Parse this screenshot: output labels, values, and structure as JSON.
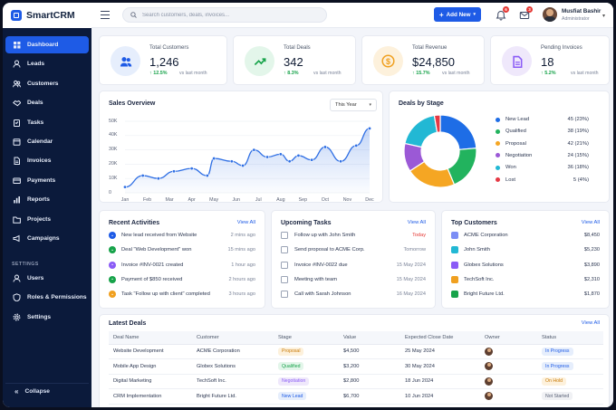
{
  "brand": {
    "name": "SmartCRM"
  },
  "sidebar": {
    "items": [
      {
        "label": "Dashboard",
        "icon": "grid-icon",
        "active": true
      },
      {
        "label": "Leads",
        "icon": "person-icon"
      },
      {
        "label": "Customers",
        "icon": "users-icon"
      },
      {
        "label": "Deals",
        "icon": "handshake-icon"
      },
      {
        "label": "Tasks",
        "icon": "clipboard-icon"
      },
      {
        "label": "Calendar",
        "icon": "calendar-icon"
      },
      {
        "label": "Invoices",
        "icon": "file-icon"
      },
      {
        "label": "Payments",
        "icon": "card-icon"
      },
      {
        "label": "Reports",
        "icon": "chart-icon"
      },
      {
        "label": "Projects",
        "icon": "folder-icon"
      },
      {
        "label": "Campaigns",
        "icon": "megaphone-icon"
      }
    ],
    "settings_header": "SETTINGS",
    "settings_items": [
      {
        "label": "Users",
        "icon": "user-icon"
      },
      {
        "label": "Roles & Permissions",
        "icon": "shield-icon"
      },
      {
        "label": "Settings",
        "icon": "gear-icon"
      }
    ],
    "collapse_label": "Collapse"
  },
  "topbar": {
    "search_placeholder": "Search customers, deals, invoices...",
    "add_new_label": "Add New",
    "notification_count": "6",
    "mail_count": "3",
    "user_name": "Musfiat Bashir",
    "user_role": "Administrator"
  },
  "stats": [
    {
      "label": "Total Customers",
      "value": "1,246",
      "change": "12.5%",
      "vs": "vs last month",
      "color": "#e6eefc",
      "icon_color": "#1e5be6",
      "icon": "users-icon"
    },
    {
      "label": "Total Deals",
      "value": "342",
      "change": "8.3%",
      "vs": "vs last month",
      "color": "#e3f6ea",
      "icon_color": "#17a34a",
      "icon": "trend-up-icon"
    },
    {
      "label": "Total Revenue",
      "value": "$24,850",
      "change": "15.7%",
      "vs": "vs last month",
      "color": "#fdf1dc",
      "icon_color": "#f0a020",
      "icon": "dollar-icon"
    },
    {
      "label": "Pending Invoices",
      "value": "18",
      "change": "5.2%",
      "vs": "vs last month",
      "color": "#efe8fb",
      "icon_color": "#8b5cf6",
      "icon": "invoice-icon"
    }
  ],
  "sales": {
    "title": "Sales Overview",
    "period": "This Year"
  },
  "stage": {
    "title": "Deals by Stage",
    "items": [
      {
        "label": "New Lead",
        "value": "45 (23%)",
        "color": "#1e6de6"
      },
      {
        "label": "Qualified",
        "value": "38 (19%)",
        "color": "#22b35e"
      },
      {
        "label": "Proposal",
        "value": "42 (21%)",
        "color": "#f5a623"
      },
      {
        "label": "Negotiation",
        "value": "24 (15%)",
        "color": "#9b59d6"
      },
      {
        "label": "Won",
        "value": "36 (18%)",
        "color": "#22b8d4"
      },
      {
        "label": "Lost",
        "value": "5 (4%)",
        "color": "#e53945"
      }
    ]
  },
  "activities": {
    "title": "Recent Activities",
    "view_all": "View All",
    "items": [
      {
        "text": "New lead received from Website",
        "time": "2 mins ago",
        "color": "#1e5be6"
      },
      {
        "text": "Deal \"Web Development\" won",
        "time": "15 mins ago",
        "color": "#17a34a"
      },
      {
        "text": "Invoice #INV-0021 created",
        "time": "1 hour ago",
        "color": "#8b5cf6"
      },
      {
        "text": "Payment of $850 received",
        "time": "2 hours ago",
        "color": "#17a34a"
      },
      {
        "text": "Task \"Follow up with client\" completed",
        "time": "3 hours ago",
        "color": "#f0a020"
      }
    ]
  },
  "tasks": {
    "title": "Upcoming Tasks",
    "view_all": "View All",
    "items": [
      {
        "text": "Follow up with John Smith",
        "when": "Today",
        "urgent": true
      },
      {
        "text": "Send proposal to ACME Corp.",
        "when": "Tomorrow"
      },
      {
        "text": "Invoice #INV-0022 due",
        "when": "15 May 2024"
      },
      {
        "text": "Meeting with team",
        "when": "15 May 2024"
      },
      {
        "text": "Call with Sarah Johnson",
        "when": "16 May 2024"
      }
    ]
  },
  "customers": {
    "title": "Top Customers",
    "view_all": "View All",
    "items": [
      {
        "name": "ACME Corporation",
        "amount": "$8,450",
        "color": "#7c8ef5"
      },
      {
        "name": "John Smith",
        "amount": "$5,230",
        "color": "#22b8d4"
      },
      {
        "name": "Globex Solutions",
        "amount": "$3,890",
        "color": "#8b5cf6"
      },
      {
        "name": "TechSoft Inc.",
        "amount": "$2,310",
        "color": "#f0a020"
      },
      {
        "name": "Bright Future Ltd.",
        "amount": "$1,870",
        "color": "#17a34a"
      }
    ]
  },
  "deals": {
    "title": "Latest Deals",
    "view_all": "View All",
    "columns": [
      "Deal Name",
      "Customer",
      "Stage",
      "Value",
      "Expected Close Date",
      "Owner",
      "Status"
    ],
    "rows": [
      {
        "name": "Website Development",
        "customer": "ACME Corporation",
        "stage": "Proposal",
        "stage_bg": "#fdf1dc",
        "stage_fg": "#c97a06",
        "value": "$4,500",
        "date": "25 May 2024",
        "status": "In Progress",
        "status_bg": "#e6eefc",
        "status_fg": "#1e5be6"
      },
      {
        "name": "Mobile App Design",
        "customer": "Globex Solutions",
        "stage": "Qualified",
        "stage_bg": "#e3f6ea",
        "stage_fg": "#17a34a",
        "value": "$3,200",
        "date": "30 May 2024",
        "status": "In Progress",
        "status_bg": "#e6eefc",
        "status_fg": "#1e5be6"
      },
      {
        "name": "Digital Marketing",
        "customer": "TechSoft Inc.",
        "stage": "Negotiation",
        "stage_bg": "#efe8fb",
        "stage_fg": "#8b5cf6",
        "value": "$2,800",
        "date": "18 Jun 2024",
        "status": "On Hold",
        "status_bg": "#fdf1dc",
        "status_fg": "#c97a06"
      },
      {
        "name": "CRM Implementation",
        "customer": "Bright Future Ltd.",
        "stage": "New Lead",
        "stage_bg": "#e6eefc",
        "stage_fg": "#1e5be6",
        "value": "$6,700",
        "date": "10 Jun 2024",
        "status": "Not Started",
        "status_bg": "#f0f1f4",
        "status_fg": "#596176"
      }
    ]
  },
  "chart_data": [
    {
      "type": "area",
      "title": "Sales Overview",
      "categories": [
        "Jan",
        "Feb",
        "Mar",
        "Apr",
        "May",
        "Jun",
        "Jul",
        "Aug",
        "Sep",
        "Oct",
        "Nov",
        "Dec"
      ],
      "y_ticks": [
        "0",
        "10K",
        "20K",
        "30K",
        "40K",
        "50K"
      ],
      "ylim": [
        0,
        50000
      ],
      "values": [
        4000,
        12000,
        10000,
        15000,
        17000,
        12000,
        24000,
        22000,
        19000,
        30000,
        25000,
        27000,
        22000,
        26000,
        23000,
        32000,
        22000,
        33000,
        45000
      ],
      "x_positions": [
        0,
        0.8,
        1.5,
        2.2,
        3.0,
        3.7,
        4.0,
        4.8,
        5.3,
        5.8,
        6.4,
        7.0,
        7.4,
        7.8,
        8.4,
        9.0,
        9.7,
        10.4,
        11.0
      ],
      "color": "#2f6fe4"
    },
    {
      "type": "pie",
      "title": "Deals by Stage",
      "categories": [
        "New Lead",
        "Qualified",
        "Proposal",
        "Negotiation",
        "Won",
        "Lost"
      ],
      "values": [
        45,
        38,
        42,
        24,
        36,
        5
      ]
    }
  ]
}
